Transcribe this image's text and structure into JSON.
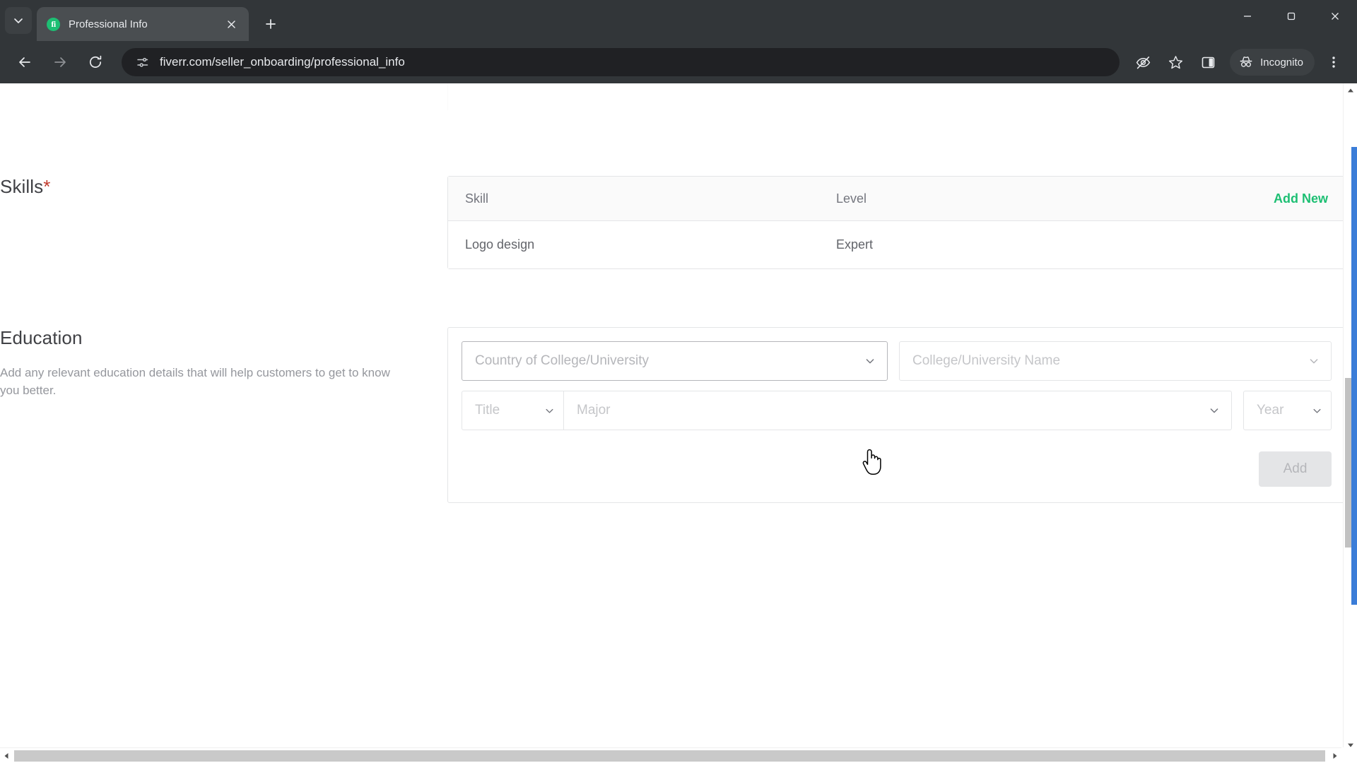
{
  "browser": {
    "tab": {
      "title": "Professional Info",
      "favicon_text": "fi",
      "favicon_color": "#1dbf73",
      "close_icon": "close-icon"
    },
    "tab_search_icon": "chevron-down-icon",
    "new_tab_icon": "plus-icon",
    "window_controls": {
      "minimize": "minimize-icon",
      "maximize": "maximize-icon",
      "close": "close-icon"
    },
    "toolbar": {
      "back_icon": "arrow-left-icon",
      "forward_icon": "arrow-right-icon",
      "reload_icon": "reload-icon",
      "site_info_icon": "tune-icon",
      "url": "fiverr.com/seller_onboarding/professional_info",
      "tracking_protection_icon": "eye-slash-icon",
      "bookmark_icon": "star-icon",
      "side_panel_icon": "side-panel-icon",
      "incognito_label": "Incognito",
      "incognito_icon": "incognito-hat-icon",
      "menu_icon": "three-dot-menu-icon"
    }
  },
  "page": {
    "skills": {
      "title": "Skills",
      "required_marker": "*",
      "table": {
        "columns": [
          "Skill",
          "Level"
        ],
        "add_new_label": "Add New",
        "add_new_color": "#1dbf73",
        "rows": [
          {
            "skill": "Logo design",
            "level": "Expert"
          }
        ]
      }
    },
    "education": {
      "title": "Education",
      "description": "Add any relevant education details that will help customers to get to know you better.",
      "fields": {
        "country": {
          "placeholder": "Country of College/University",
          "value": "",
          "icon": "chevron-down-icon"
        },
        "college": {
          "placeholder": "College/University Name",
          "value": "",
          "icon": "chevron-down-icon"
        },
        "title": {
          "placeholder": "Title",
          "value": "",
          "icon": "chevron-down-icon"
        },
        "major": {
          "placeholder": "Major",
          "value": "",
          "icon": "chevron-down-icon"
        },
        "year": {
          "placeholder": "Year",
          "value": "",
          "icon": "chevron-down-icon"
        }
      },
      "add_button": {
        "label": "Add",
        "disabled": true
      }
    }
  },
  "scrollbars": {
    "vertical": {
      "up_icon": "triangle-up-icon",
      "down_icon": "triangle-down-icon"
    },
    "horizontal": {
      "left_icon": "triangle-left-icon",
      "right_icon": "triangle-right-icon"
    }
  },
  "cursor": {
    "type": "pointer-hand-cursor"
  }
}
